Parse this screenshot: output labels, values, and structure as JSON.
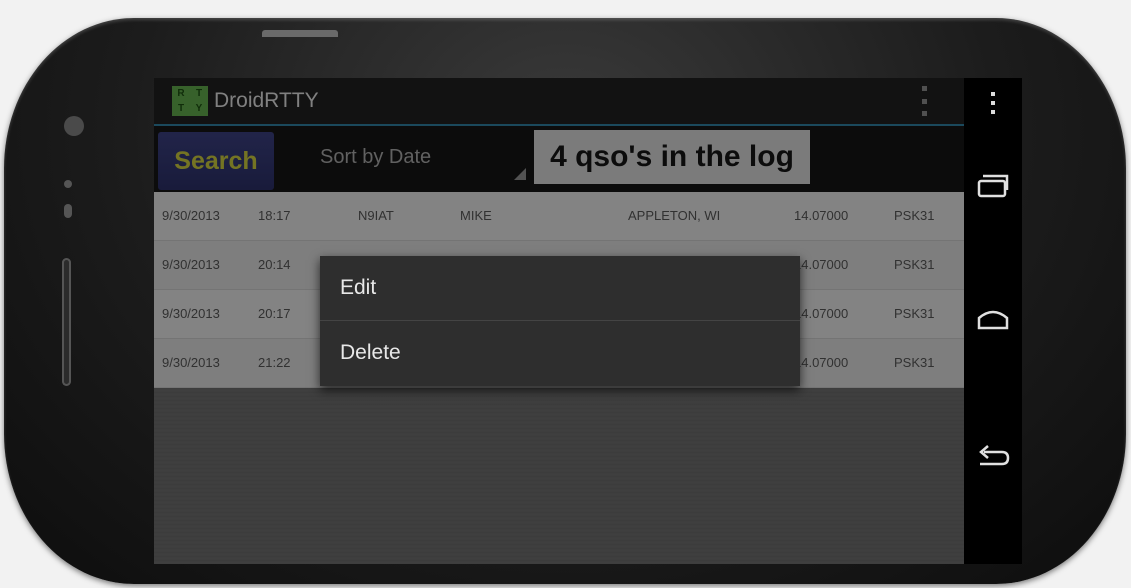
{
  "app": {
    "title": "DroidRTTY",
    "icon_letters": [
      "R",
      "T",
      "T",
      "Y"
    ]
  },
  "toolbar": {
    "search_label": "Search",
    "sort_label": "Sort by Date",
    "qso_count_label": "4 qso's in the log"
  },
  "log": {
    "rows": [
      {
        "date": "9/30/2013",
        "time": "18:17",
        "call": "N9IAT",
        "name": "MIKE",
        "qth": "APPLETON, WI",
        "freq": "14.07000",
        "mode": "PSK31"
      },
      {
        "date": "9/30/2013",
        "time": "20:14",
        "call": "",
        "name": "",
        "qth": "",
        "freq": "14.07000",
        "mode": "PSK31"
      },
      {
        "date": "9/30/2013",
        "time": "20:17",
        "call": "",
        "name": "",
        "qth": "",
        "freq": "14.07000",
        "mode": "PSK31"
      },
      {
        "date": "9/30/2013",
        "time": "21:22",
        "call": "",
        "name": "",
        "qth": "",
        "freq": "14.07000",
        "mode": "PSK31"
      }
    ]
  },
  "context_menu": {
    "items": [
      "Edit",
      "Delete"
    ]
  },
  "icons": {
    "overflow": "overflow-menu-icon",
    "recents": "recent-apps-icon",
    "home": "home-icon",
    "back": "back-icon"
  },
  "colors": {
    "accent": "#2f7f9f",
    "search_bg": "#3a3f7e",
    "search_text": "#c9c93d",
    "app_icon": "#5fa84a"
  }
}
